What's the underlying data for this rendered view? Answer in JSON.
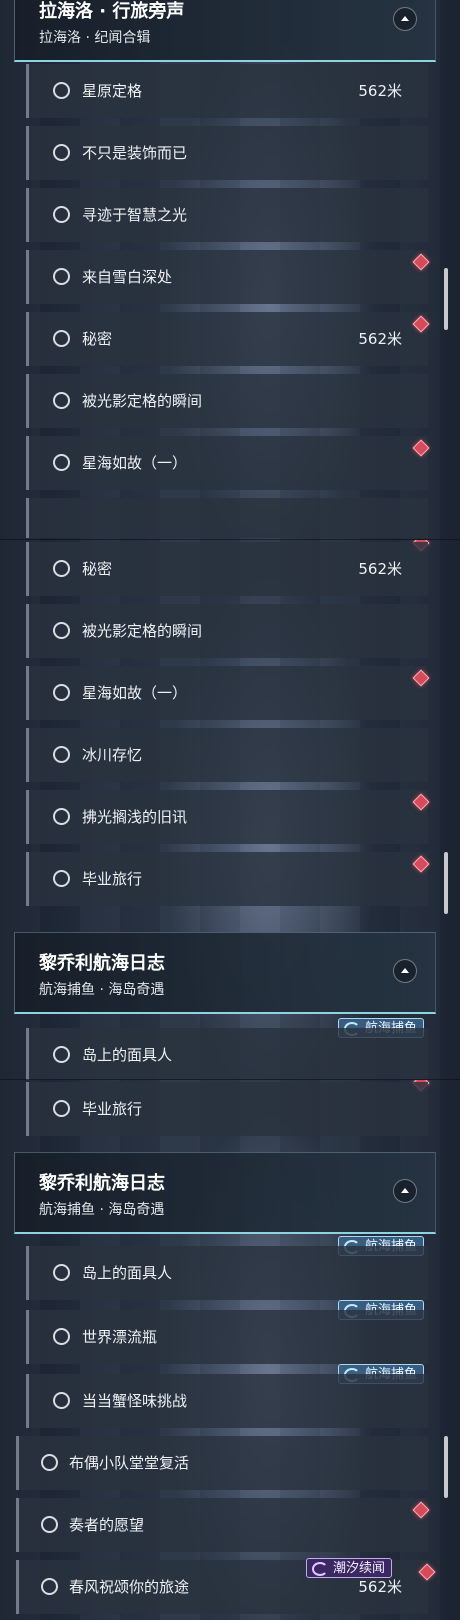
{
  "panel1": {
    "header": {
      "title": "拉海洛 · 行旅旁声",
      "subtitle": "拉海洛 · 纪闻合辑"
    },
    "rows": [
      {
        "label": "星原定格",
        "distance": "562米"
      },
      {
        "label": "不只是装饰而已"
      },
      {
        "label": "寻迹于智慧之光"
      },
      {
        "label": "来自雪白深处"
      },
      {
        "label": "秘密",
        "distance": "562米"
      },
      {
        "label": "被光影定格的瞬间"
      },
      {
        "label": "星海如故（一）"
      }
    ]
  },
  "panel2": {
    "rows": [
      {
        "label": "秘密",
        "distance": "562米"
      },
      {
        "label": "被光影定格的瞬间"
      },
      {
        "label": "星海如故（一）"
      },
      {
        "label": "冰川存忆"
      },
      {
        "label": "拂光搁浅的旧讯"
      },
      {
        "label": "毕业旅行"
      }
    ],
    "header": {
      "title": "黎乔利航海日志",
      "subtitle": "航海捕鱼 · 海岛奇遇"
    },
    "after_rows": [
      {
        "label": "岛上的面具人"
      }
    ],
    "tag_label": "航海捕鱼"
  },
  "panel3": {
    "rows_before": [
      {
        "label": "毕业旅行"
      }
    ],
    "header": {
      "title": "黎乔利航海日志",
      "subtitle": "航海捕鱼 · 海岛奇遇"
    },
    "rows": [
      {
        "label": "岛上的面具人"
      },
      {
        "label": "世界漂流瓶"
      },
      {
        "label": "当当蟹怪味挑战"
      }
    ],
    "rows_wide": [
      {
        "label": "布偶小队堂堂复活"
      },
      {
        "label": "奏者的愿望"
      },
      {
        "label": "春风祝颂你的旅途",
        "distance": "562米"
      }
    ],
    "tag_label": "航海捕鱼",
    "tag_purple_label": "潮汐续闻"
  },
  "colors": {
    "accent": "#8fd2e0",
    "marker": "#d64a5a",
    "tag": "#3c648c",
    "tag_purple": "#3c2864"
  }
}
